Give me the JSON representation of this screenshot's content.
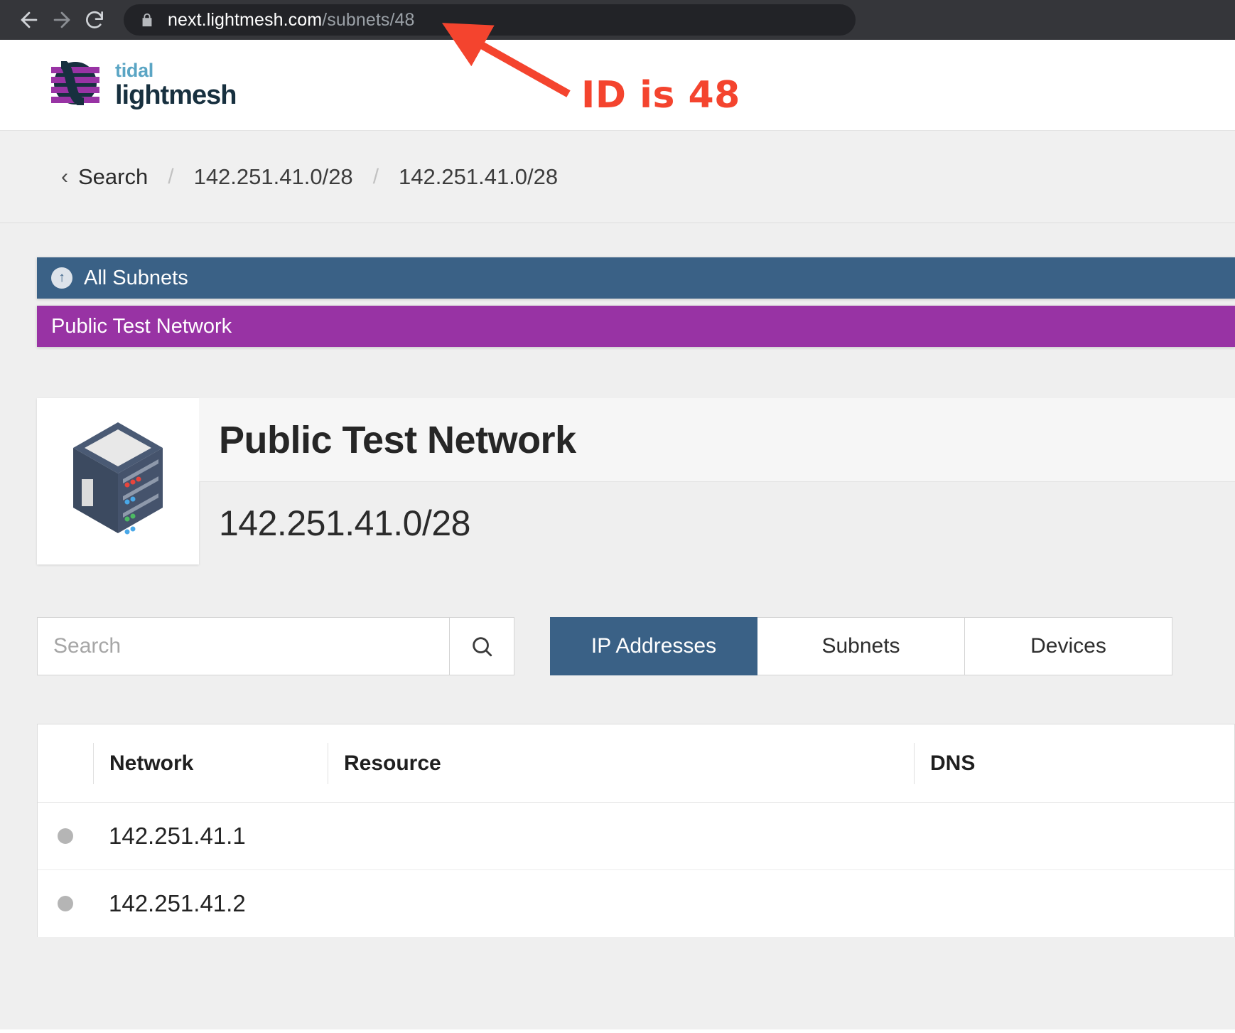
{
  "browser": {
    "back_icon": "back-arrow",
    "forward_icon": "forward-arrow",
    "reload_icon": "reload",
    "lock_icon": "lock",
    "url_host": "next.lightmesh.com",
    "url_path": "/subnets/48"
  },
  "annotation": {
    "label": "ID is 48",
    "color": "#f4442e"
  },
  "header": {
    "logo_top": "tidal",
    "logo_bottom": "lightmesh",
    "logo_mark": "lightmesh-wave-logo"
  },
  "breadcrumb": {
    "back_label": "Search",
    "separator": "/",
    "items": [
      {
        "label": "142.251.41.0/28"
      },
      {
        "label": "142.251.41.0/28"
      }
    ]
  },
  "bands": {
    "all_subnets": {
      "label": "All Subnets",
      "icon": "arrow-up-circle-icon",
      "color": "#3a6186"
    },
    "current": {
      "label": "Public Test Network",
      "color": "#9833a4"
    }
  },
  "detail": {
    "icon": "server-rack-icon",
    "title": "Public Test Network",
    "cidr": "142.251.41.0/28"
  },
  "search": {
    "placeholder": "Search",
    "value": "",
    "button_icon": "search-icon"
  },
  "tabs": [
    {
      "label": "IP Addresses",
      "active": true
    },
    {
      "label": "Subnets",
      "active": false
    },
    {
      "label": "Devices",
      "active": false
    }
  ],
  "table": {
    "columns": [
      "Network",
      "Resource",
      "DNS"
    ],
    "rows": [
      {
        "status": "inactive",
        "network": "142.251.41.1",
        "resource": "",
        "dns": ""
      },
      {
        "status": "inactive",
        "network": "142.251.41.2",
        "resource": "",
        "dns": ""
      }
    ]
  }
}
